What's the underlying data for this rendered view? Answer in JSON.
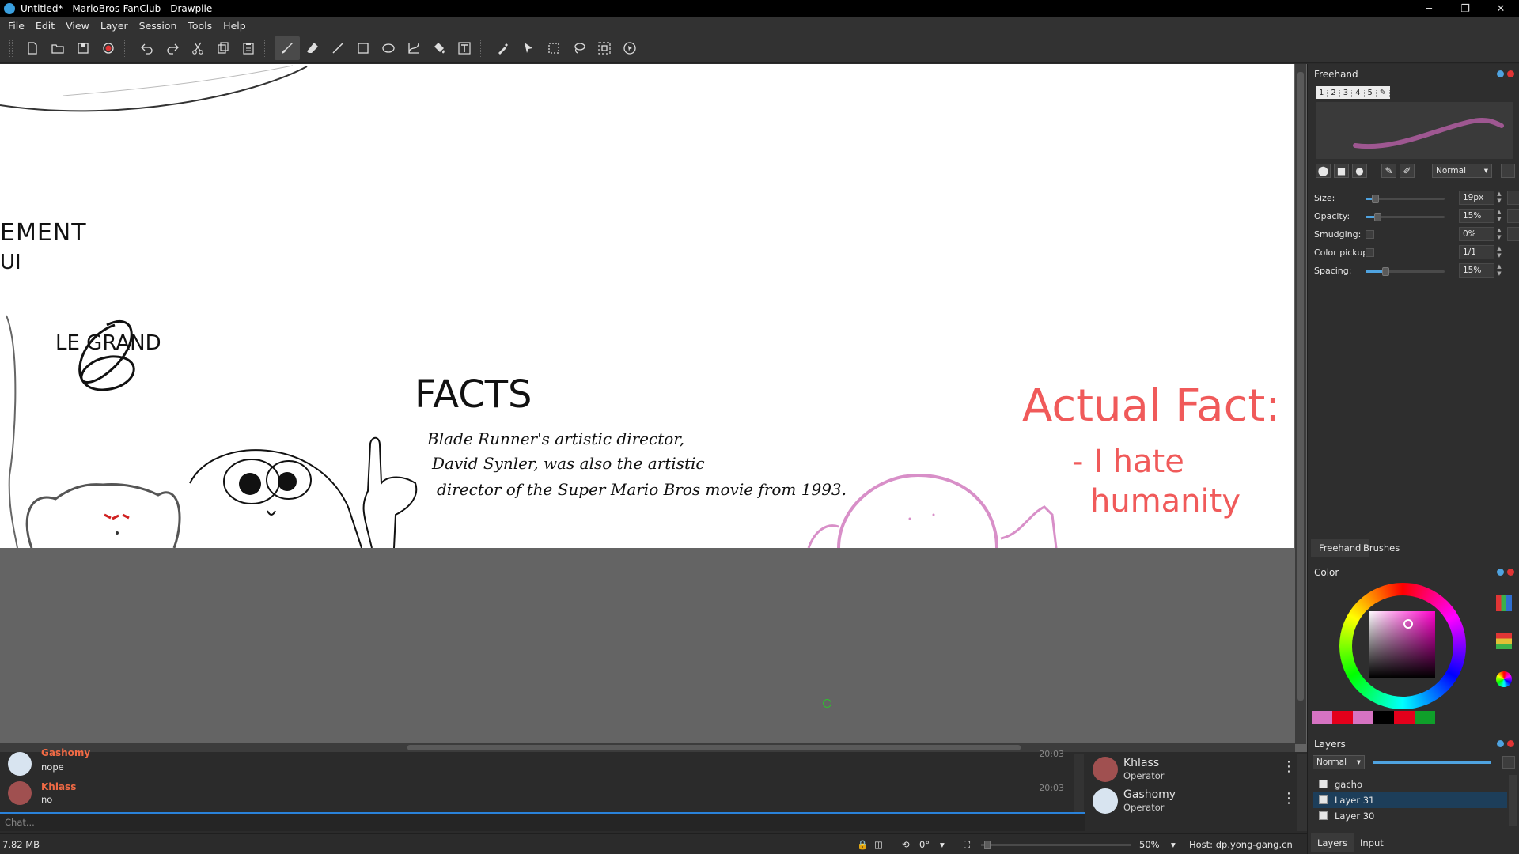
{
  "window": {
    "title": "Untitled* - MarioBros-FanClub - Drawpile",
    "controls": {
      "minimize": "─",
      "maximize": "❐",
      "close": "✕"
    }
  },
  "menu": [
    {
      "label": "File",
      "accel": "F"
    },
    {
      "label": "Edit",
      "accel": "E"
    },
    {
      "label": "View",
      "accel": "V"
    },
    {
      "label": "Layer",
      "accel": "L"
    },
    {
      "label": "Session",
      "accel": "S"
    },
    {
      "label": "Tools",
      "accel": "T"
    },
    {
      "label": "Help",
      "accel": "H"
    }
  ],
  "toolbar": {
    "file_tools": [
      "new-icon",
      "open-icon",
      "save-icon",
      "record-icon"
    ],
    "edit_tools": [
      "undo-icon",
      "redo-icon",
      "cut-icon",
      "copy-icon",
      "paste-icon"
    ],
    "draw_tools": [
      "brush-icon",
      "eraser-icon",
      "line-icon",
      "rectangle-icon",
      "ellipse-icon",
      "bezier-icon",
      "fill-icon",
      "text-icon",
      "color-picker-icon",
      "laser-pointer-icon",
      "select-rect-icon",
      "lasso-icon",
      "zoom-icon",
      "inspector-icon"
    ],
    "active_tool": "brush-icon"
  },
  "canvas": {
    "notes_left_top": "EMENT",
    "notes_left_sub": "UI",
    "notes_left_big": "8",
    "notes_le_grand": "LE GRAND",
    "facts_title": "FACTS",
    "facts_lines": [
      "Blade Runner's artistic director,",
      "David Synler, was also the artistic",
      "director of the Super Mario Bros movie from 1993."
    ],
    "actual_fact_title": "Actual Fact:",
    "actual_fact_lines": [
      "- I hate",
      "humanity"
    ],
    "colors": {
      "pink": "#d88fc8",
      "red": "#f05a5a"
    }
  },
  "chat": {
    "messages": [
      {
        "user": "Gashomy",
        "text": "nope",
        "time": "20:03",
        "avatar": "G"
      },
      {
        "user": "Khlass",
        "text": "no",
        "time": "20:03",
        "avatar": "K"
      }
    ],
    "input_placeholder": "Chat..."
  },
  "users": [
    {
      "name": "Khlass",
      "role": "Operator",
      "avatar": "K"
    },
    {
      "name": "Gashomy",
      "role": "Operator",
      "avatar": "G"
    }
  ],
  "status": {
    "memory": "7.82 MB",
    "rotation": "0°",
    "zoom": "50%",
    "host": "Host: dp.yong-gang.cn"
  },
  "freehand_panel": {
    "title": "Freehand",
    "presets": [
      "1",
      "2",
      "3",
      "4",
      "5"
    ],
    "blend_mode": "Normal",
    "settings": [
      {
        "label": "Size:",
        "value": "19px",
        "level": 0.12,
        "kind": "slider"
      },
      {
        "label": "Opacity:",
        "value": "15%",
        "level": 0.15,
        "kind": "slider"
      },
      {
        "label": "Smudging:",
        "value": "0%",
        "level": 0.0,
        "kind": "check"
      },
      {
        "label": "Color pickup:",
        "value": "1/1",
        "level": 0.0,
        "kind": "check"
      },
      {
        "label": "Spacing:",
        "value": "15%",
        "level": 0.25,
        "kind": "slider"
      }
    ],
    "tabs": [
      "Freehand",
      "Brushes"
    ]
  },
  "color_panel": {
    "title": "Color",
    "current_color": "#b0188a",
    "swatches": [
      "#d673c2",
      "#e4001b",
      "#d673c2",
      "#000000",
      "#e4001b",
      "#0f9f2a"
    ]
  },
  "layers_panel": {
    "title": "Layers",
    "blend_mode": "Normal",
    "layers": [
      {
        "name": "gacho",
        "selected": false
      },
      {
        "name": "Layer 31",
        "selected": true
      },
      {
        "name": "Layer 30",
        "selected": false
      }
    ],
    "tabs": [
      "Layers",
      "Input"
    ]
  }
}
